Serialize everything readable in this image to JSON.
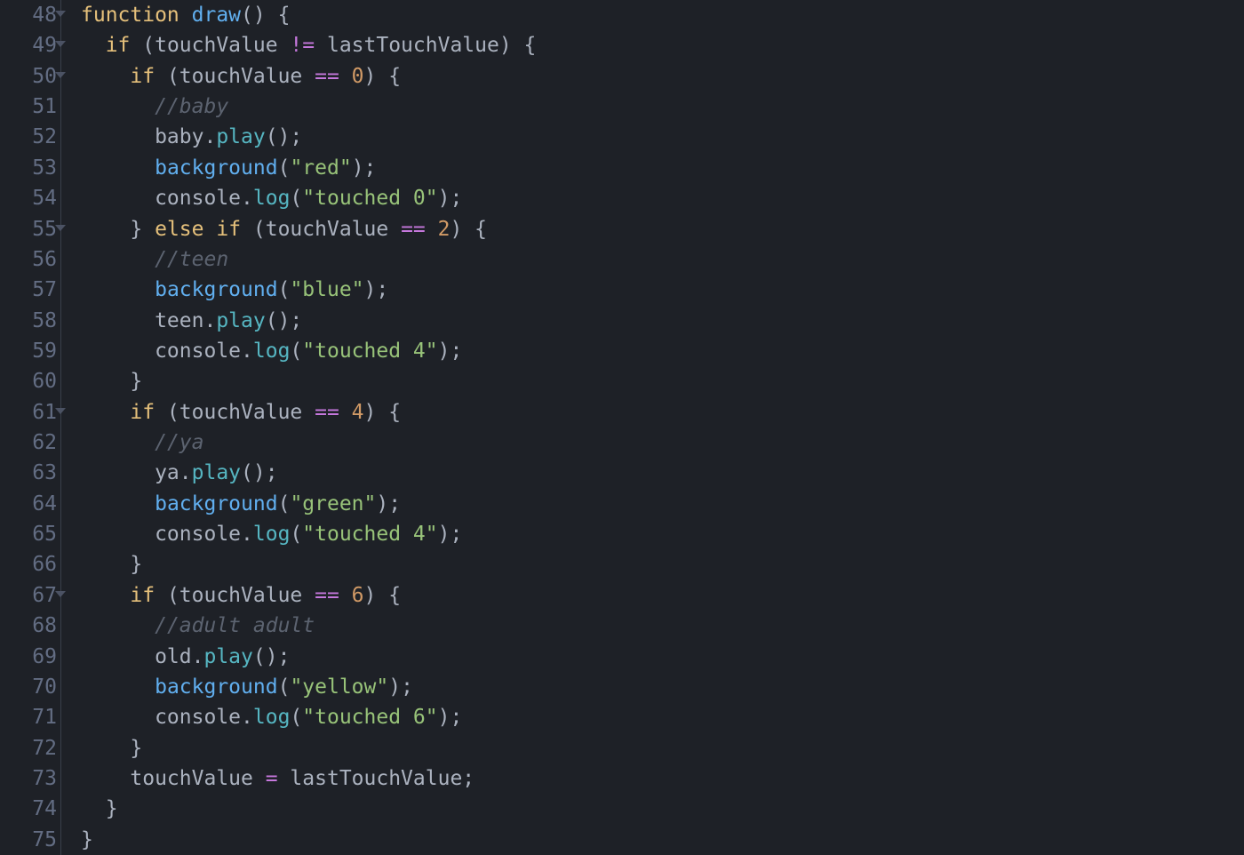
{
  "firstLine": 48,
  "foldLines": [
    48,
    49,
    50,
    55,
    61,
    67
  ],
  "code": [
    [
      [
        "kw",
        "function"
      ],
      [
        "punc",
        " "
      ],
      [
        "fn",
        "draw"
      ],
      [
        "punc",
        "() {"
      ]
    ],
    [
      [
        "punc",
        "  "
      ],
      [
        "kw",
        "if"
      ],
      [
        "punc",
        " (touchValue "
      ],
      [
        "op",
        "!="
      ],
      [
        "punc",
        " lastTouchValue) {"
      ]
    ],
    [
      [
        "punc",
        "    "
      ],
      [
        "kw",
        "if"
      ],
      [
        "punc",
        " (touchValue "
      ],
      [
        "op",
        "=="
      ],
      [
        "punc",
        " "
      ],
      [
        "num",
        "0"
      ],
      [
        "punc",
        ") {"
      ]
    ],
    [
      [
        "punc",
        "      "
      ],
      [
        "cmt",
        "//baby"
      ]
    ],
    [
      [
        "punc",
        "      baby."
      ],
      [
        "meth",
        "play"
      ],
      [
        "punc",
        "();"
      ]
    ],
    [
      [
        "punc",
        "      "
      ],
      [
        "fn",
        "background"
      ],
      [
        "punc",
        "("
      ],
      [
        "str",
        "\"red\""
      ],
      [
        "punc",
        ");"
      ]
    ],
    [
      [
        "punc",
        "      console."
      ],
      [
        "meth",
        "log"
      ],
      [
        "punc",
        "("
      ],
      [
        "str",
        "\"touched 0\""
      ],
      [
        "punc",
        ");"
      ]
    ],
    [
      [
        "punc",
        "    } "
      ],
      [
        "kw",
        "else"
      ],
      [
        "punc",
        " "
      ],
      [
        "kw",
        "if"
      ],
      [
        "punc",
        " (touchValue "
      ],
      [
        "op",
        "=="
      ],
      [
        "punc",
        " "
      ],
      [
        "num",
        "2"
      ],
      [
        "punc",
        ") {"
      ]
    ],
    [
      [
        "punc",
        "      "
      ],
      [
        "cmt",
        "//teen"
      ]
    ],
    [
      [
        "punc",
        "      "
      ],
      [
        "fn",
        "background"
      ],
      [
        "punc",
        "("
      ],
      [
        "str",
        "\"blue\""
      ],
      [
        "punc",
        ");"
      ]
    ],
    [
      [
        "punc",
        "      teen."
      ],
      [
        "meth",
        "play"
      ],
      [
        "punc",
        "();"
      ]
    ],
    [
      [
        "punc",
        "      console."
      ],
      [
        "meth",
        "log"
      ],
      [
        "punc",
        "("
      ],
      [
        "str",
        "\"touched 4\""
      ],
      [
        "punc",
        ");"
      ]
    ],
    [
      [
        "punc",
        "    }"
      ]
    ],
    [
      [
        "punc",
        "    "
      ],
      [
        "kw",
        "if"
      ],
      [
        "punc",
        " (touchValue "
      ],
      [
        "op",
        "=="
      ],
      [
        "punc",
        " "
      ],
      [
        "num",
        "4"
      ],
      [
        "punc",
        ") {"
      ]
    ],
    [
      [
        "punc",
        "      "
      ],
      [
        "cmt",
        "//ya"
      ]
    ],
    [
      [
        "punc",
        "      ya."
      ],
      [
        "meth",
        "play"
      ],
      [
        "punc",
        "();"
      ]
    ],
    [
      [
        "punc",
        "      "
      ],
      [
        "fn",
        "background"
      ],
      [
        "punc",
        "("
      ],
      [
        "str",
        "\"green\""
      ],
      [
        "punc",
        ");"
      ]
    ],
    [
      [
        "punc",
        "      console."
      ],
      [
        "meth",
        "log"
      ],
      [
        "punc",
        "("
      ],
      [
        "str",
        "\"touched 4\""
      ],
      [
        "punc",
        ");"
      ]
    ],
    [
      [
        "punc",
        "    }"
      ]
    ],
    [
      [
        "punc",
        "    "
      ],
      [
        "kw",
        "if"
      ],
      [
        "punc",
        " (touchValue "
      ],
      [
        "op",
        "=="
      ],
      [
        "punc",
        " "
      ],
      [
        "num",
        "6"
      ],
      [
        "punc",
        ") {"
      ]
    ],
    [
      [
        "punc",
        "      "
      ],
      [
        "cmt",
        "//adult adult"
      ]
    ],
    [
      [
        "punc",
        "      old."
      ],
      [
        "meth",
        "play"
      ],
      [
        "punc",
        "();"
      ]
    ],
    [
      [
        "punc",
        "      "
      ],
      [
        "fn",
        "background"
      ],
      [
        "punc",
        "("
      ],
      [
        "str",
        "\"yellow\""
      ],
      [
        "punc",
        ");"
      ]
    ],
    [
      [
        "punc",
        "      console."
      ],
      [
        "meth",
        "log"
      ],
      [
        "punc",
        "("
      ],
      [
        "str",
        "\"touched 6\""
      ],
      [
        "punc",
        ");"
      ]
    ],
    [
      [
        "punc",
        "    }"
      ]
    ],
    [
      [
        "punc",
        "    touchValue "
      ],
      [
        "op",
        "="
      ],
      [
        "punc",
        " lastTouchValue;"
      ]
    ],
    [
      [
        "punc",
        "  }"
      ]
    ],
    [
      [
        "punc",
        "}"
      ]
    ]
  ]
}
